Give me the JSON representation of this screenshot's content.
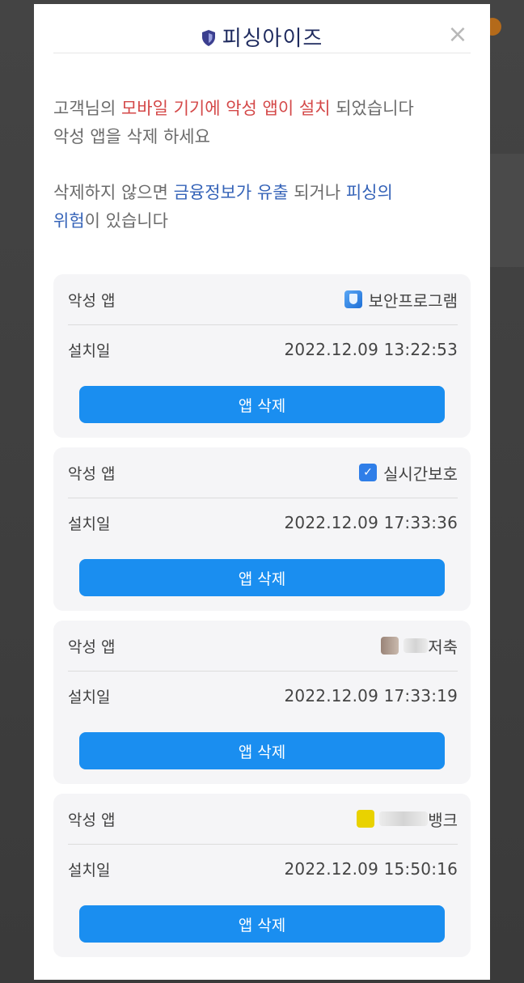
{
  "dialog": {
    "title": "피싱아이즈",
    "close_symbol": "×"
  },
  "message": {
    "line1_prefix": "고객님의 ",
    "line1_highlight": "모바일 기기에 악성 앱이 설치",
    "line1_suffix": " 되었습니다",
    "line2": "악성 앱을 삭제 하세요",
    "line3_prefix": "삭제하지 않으면 ",
    "line3_highlight": "금융정보가 유출",
    "line3_mid": " 되거나 ",
    "line3_highlight2": "피싱의",
    "line4_highlight": "위험",
    "line4_suffix": "이 있습니다"
  },
  "labels": {
    "malicious_app": "악성 앱",
    "install_date": "설치일",
    "delete_button": "앱 삭제"
  },
  "apps": [
    {
      "name": "보안프로그램",
      "icon": "shield-icon",
      "installed": "2022.12.09 13:22:53"
    },
    {
      "name": "실시간보호",
      "icon": "shield-check-icon",
      "installed": "2022.12.09 17:33:36"
    },
    {
      "name": "저축",
      "icon": "blurred-app-icon",
      "installed": "2022.12.09 17:33:19"
    },
    {
      "name": "뱅크",
      "icon": "blurred-app-icon",
      "installed": "2022.12.09 15:50:16"
    }
  ],
  "colors": {
    "accent": "#1a8ef0",
    "warning_red": "#d44848",
    "info_blue": "#3563b8",
    "title_navy": "#1e2a5e"
  }
}
